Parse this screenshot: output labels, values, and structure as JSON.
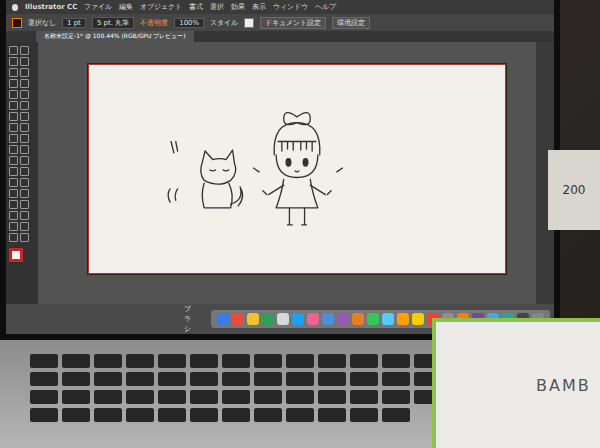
{
  "menu_bar": {
    "app": "Illustrator CC",
    "items": [
      "ファイル",
      "編集",
      "オブジェクト",
      "書式",
      "選択",
      "効果",
      "表示",
      "ウィンドウ",
      "ヘルプ"
    ]
  },
  "control_bar": {
    "selection": "選択なし",
    "stroke": "1 pt",
    "brush": "5 pt. 丸筆",
    "opacity_label": "不透明度",
    "opacity": "100%",
    "style_label": "スタイル",
    "buttons": [
      "ドキュメント設定",
      "環境設定"
    ]
  },
  "document_tab": {
    "title": "名称未設定-1* @ 100.44% (RGB/GPU プレビュー)",
    "selected": true
  },
  "brush_label": "ブラシ",
  "tablet_box": {
    "brand": "BAMB"
  },
  "side_object": {
    "label": "200"
  }
}
